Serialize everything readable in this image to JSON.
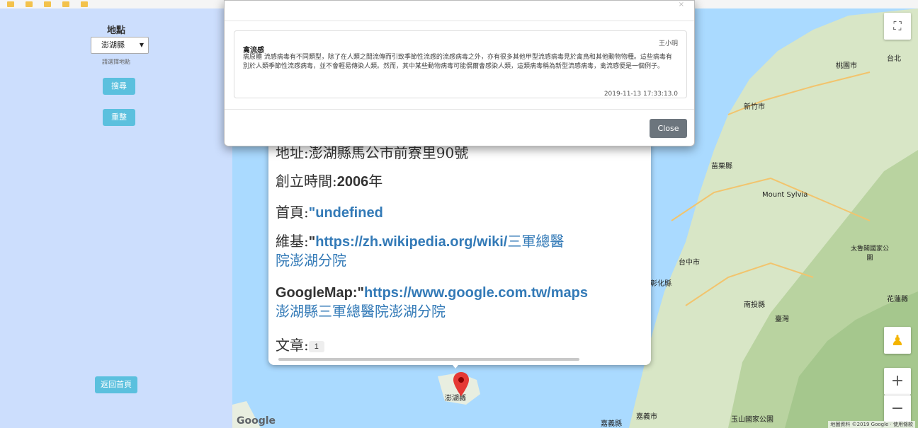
{
  "sidebar": {
    "location_label": "地點",
    "selected_county": "澎湖縣",
    "hint": "請選擇地點",
    "search_label": "搜尋",
    "reset_label": "重整",
    "back_label": "返回首頁"
  },
  "map": {
    "brand": "Google",
    "places": [
      "桃園市",
      "台北",
      "新竹市",
      "苗栗縣",
      "Mount Sylvia",
      "台中市",
      "太魯閣國家公園",
      "彰化縣",
      "南投縣",
      "臺灣",
      "花蓮縣",
      "澎湖縣",
      "嘉義市",
      "嘉義縣",
      "玉山國家公園"
    ],
    "copyright": "地圖資料 ©2019 Google · 使用條款",
    "zoom_in": "+",
    "zoom_out": "−"
  },
  "infowindow": {
    "address_label": "地址:",
    "address_value": "澎湖縣馬公市前寮里90號",
    "founded_label": "創立時間:",
    "founded_value": "2006",
    "founded_suffix": "年",
    "homepage_label": "首頁:",
    "homepage_value": "\"undefined",
    "wiki_label": "維基:",
    "wiki_quote": "\"",
    "wiki_url": "https://zh.wikipedia.org/wiki/",
    "wiki_line1": "三軍總醫",
    "wiki_line2": "院澎湖分院",
    "gmap_label": "GoogleMap:",
    "gmap_quote": "\"",
    "gmap_url": "https://www.google.com.tw/maps",
    "gmap_line2": "澎湖縣三軍總醫院澎湖分院",
    "article_label": "文章:",
    "article_count": "1"
  },
  "modal": {
    "article": {
      "title": "禽流感",
      "author": "王小明",
      "body": "病原體 流感病毒有不同類型，除了在人類之間流傳而引致季節性流感的流感病毒之外，亦有很多其他甲型流感病毒見於禽鳥和其他動物物種。這些病毒有別於人類季節性流感病毒，並不會輕易傳染人類。然而，其中某些動物病毒可能偶爾會感染人類，這類病毒稱為新型流感病毒，禽流感便是一個例子。",
      "timestamp": "2019-11-13 17:33:13.0"
    },
    "close_label": "Close"
  }
}
